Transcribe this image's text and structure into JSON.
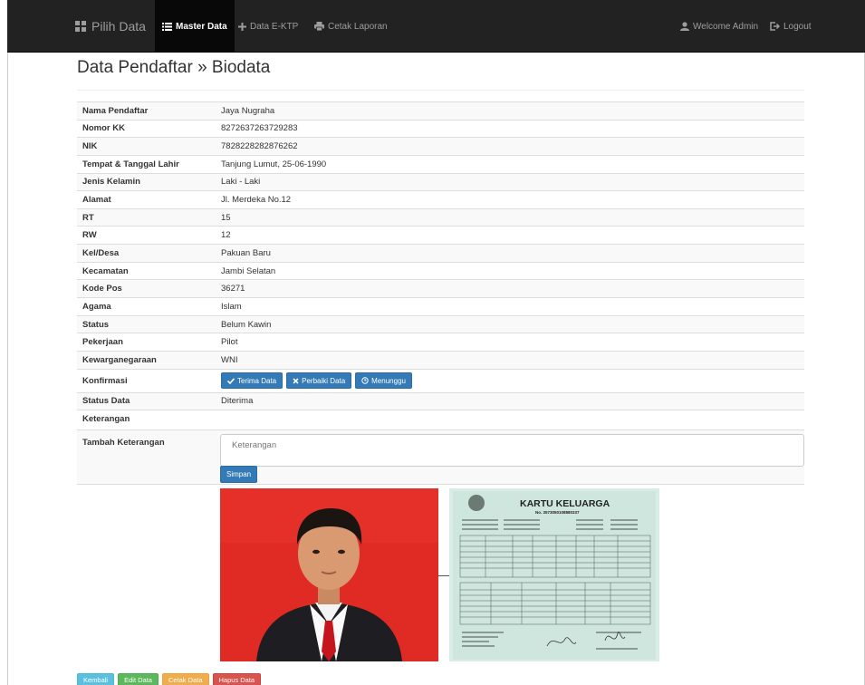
{
  "nav": {
    "brand": "Pilih Data",
    "master": "Master Data",
    "ektp": "Data E-KTP",
    "cetak": "Cetak Laporan",
    "welcome": "Welcome Admin",
    "logout": "Logout"
  },
  "page": {
    "title": "Data Pendaftar » Biodata"
  },
  "fields": [
    {
      "label": "Nama Pendaftar",
      "value": "Jaya Nugraha"
    },
    {
      "label": "Nomor KK",
      "value": "8272637263729283"
    },
    {
      "label": "NIK",
      "value": "7828228282876262"
    },
    {
      "label": "Tempat & Tanggal Lahir",
      "value": "Tanjung Lumut, 25-06-1990"
    },
    {
      "label": "Jenis Kelamin",
      "value": "Laki - Laki"
    },
    {
      "label": "Alamat",
      "value": "Jl. Merdeka No.12"
    },
    {
      "label": "RT",
      "value": "15"
    },
    {
      "label": "RW",
      "value": "12"
    },
    {
      "label": "Kel/Desa",
      "value": "Pakuan Baru"
    },
    {
      "label": "Kecamatan",
      "value": "Jambi Selatan"
    },
    {
      "label": "Kode Pos",
      "value": "36271"
    },
    {
      "label": "Agama",
      "value": "Islam"
    },
    {
      "label": "Status",
      "value": "Belum Kawin"
    },
    {
      "label": "Pekerjaan",
      "value": "Pilot"
    },
    {
      "label": "Kewarganegaraan",
      "value": "WNI"
    }
  ],
  "konfirmasi": {
    "label": "Konfirmasi",
    "terima": "Terima Data",
    "perbaiki": "Perbaiki Data",
    "menunggu": "Menunggu"
  },
  "status_data": {
    "label": "Status Data",
    "value": "Diterima"
  },
  "keterangan": {
    "label": "Keterangan",
    "value": ""
  },
  "tambah": {
    "label": "Tambah Keterangan",
    "placeholder": "Keterangan",
    "submit": "Simpan"
  },
  "kk_doc": {
    "title": "KARTU KELUARGA",
    "number": "No. 3573050108880337"
  },
  "footer": {
    "kembali": "Kembali",
    "edit": "Edit Data",
    "cetak": "Cetak Data",
    "hapus": "Hapus Data"
  },
  "colors": {
    "navbar": "#222222",
    "primary": "#337ab7",
    "info": "#5bc0de",
    "success": "#5cb85c",
    "warning": "#f0ad4e",
    "danger": "#d9534f",
    "photo_bg": "#e02a24"
  },
  "icons": {
    "brand": "grid-icon",
    "master": "list-icon",
    "ektp": "plus-icon",
    "cetak": "print-icon",
    "welcome": "user-icon",
    "logout": "logout-icon",
    "terima": "check-icon",
    "perbaiki": "x-icon",
    "menunggu": "clock-icon"
  }
}
